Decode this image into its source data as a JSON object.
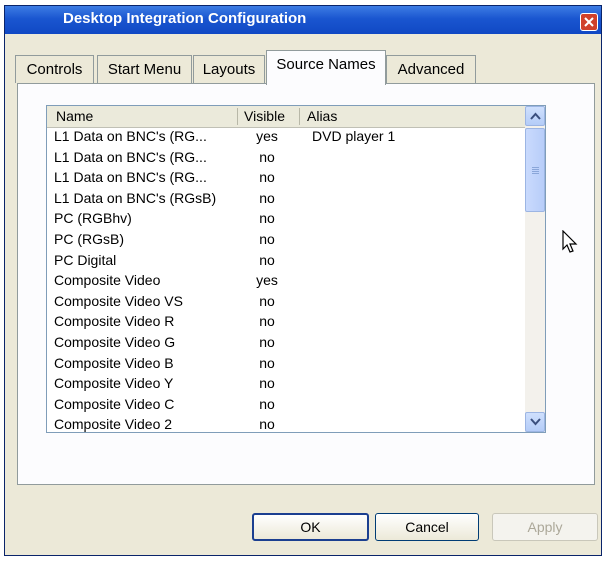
{
  "window": {
    "title": "Desktop Integration Configuration"
  },
  "tabs": [
    {
      "label": "Controls"
    },
    {
      "label": "Start Menu"
    },
    {
      "label": "Layouts"
    },
    {
      "label": "Source Names"
    },
    {
      "label": "Advanced"
    }
  ],
  "active_tab": "Source Names",
  "list": {
    "columns": {
      "name": "Name",
      "visible": "Visible",
      "alias": "Alias"
    },
    "rows": [
      {
        "name": "L1 Data on BNC's (RG...",
        "visible": "yes",
        "alias": "DVD player 1"
      },
      {
        "name": "L1 Data on BNC's (RG...",
        "visible": "no",
        "alias": ""
      },
      {
        "name": "L1 Data on BNC's (RG...",
        "visible": "no",
        "alias": ""
      },
      {
        "name": "L1 Data on BNC's (RGsB)",
        "visible": "no",
        "alias": ""
      },
      {
        "name": "PC (RGBhv)",
        "visible": "no",
        "alias": ""
      },
      {
        "name": "PC (RGsB)",
        "visible": "no",
        "alias": ""
      },
      {
        "name": "PC Digital",
        "visible": "no",
        "alias": ""
      },
      {
        "name": "Composite Video",
        "visible": "yes",
        "alias": ""
      },
      {
        "name": "Composite Video VS",
        "visible": "no",
        "alias": ""
      },
      {
        "name": "Composite Video R",
        "visible": "no",
        "alias": ""
      },
      {
        "name": "Composite Video G",
        "visible": "no",
        "alias": ""
      },
      {
        "name": "Composite Video B",
        "visible": "no",
        "alias": ""
      },
      {
        "name": "Composite Video Y",
        "visible": "no",
        "alias": ""
      },
      {
        "name": "Composite Video C",
        "visible": "no",
        "alias": ""
      },
      {
        "name": "Composite Video 2",
        "visible": "no",
        "alias": ""
      }
    ]
  },
  "buttons": {
    "ok": "OK",
    "cancel": "Cancel",
    "apply": "Apply"
  },
  "icons": {
    "close": "close-icon",
    "scroll_up": "chevron-up-icon",
    "scroll_down": "chevron-down-icon",
    "cursor": "mouse-pointer-icon"
  },
  "colors": {
    "titlebar": "#1a56d0",
    "dialog_bg": "#ece9d8",
    "close": "#d0402a"
  }
}
